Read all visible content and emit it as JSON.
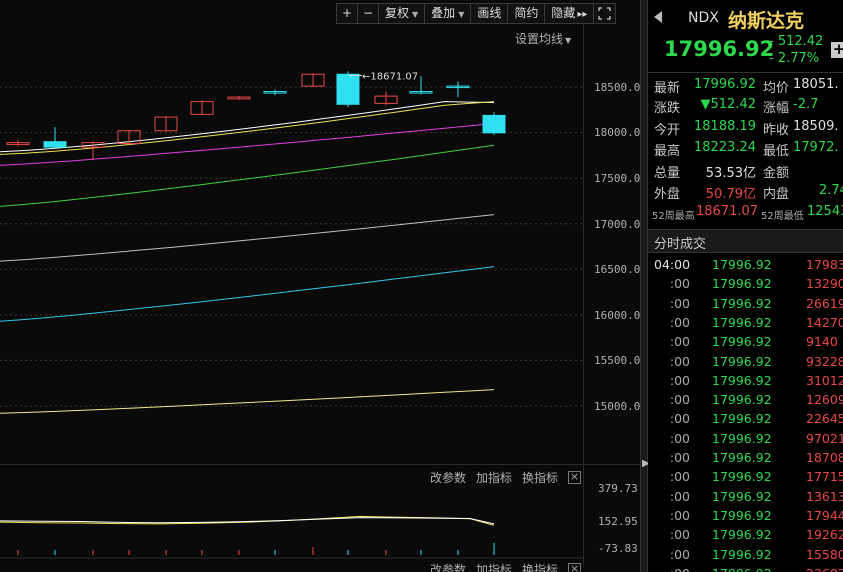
{
  "toolbar": {
    "zoom_in": "+",
    "zoom_out": "−",
    "adjust": "复权",
    "overlay": "叠加",
    "draw": "画线",
    "simple": "简约",
    "hide": "隐藏",
    "expand_arrows": "▸▸",
    "fullscreen_icon": "fullscreen-icon"
  },
  "ma_setting": "设置均线",
  "price_axis": [
    "18500.0",
    "18000.0",
    "17500.0",
    "17000.0",
    "16500.0",
    "16000.0",
    "15500.0",
    "15000.0"
  ],
  "high_marker": "18671.07",
  "indicator_panel": {
    "controls": [
      "改参数",
      "加指标",
      "换指标"
    ],
    "axis": [
      "379.73",
      "152.95",
      "-73.83"
    ]
  },
  "indicator_panel_2": {
    "controls": [
      "改参数",
      "加指标",
      "换指标"
    ]
  },
  "header": {
    "code": "NDX",
    "name": "纳斯达克"
  },
  "price": {
    "last": "17996.92",
    "change": "- 512.42",
    "change_pct": "- 2.77%",
    "add_icon": "+"
  },
  "quote": {
    "latest_label": "最新",
    "latest": "17996.92",
    "avg_label": "均价",
    "avg": "18051.",
    "chg_label": "涨跌",
    "chg": "▼512.42",
    "chgpct_label": "涨幅",
    "chgpct": "-2.7",
    "open_label": "今开",
    "open": "18188.19",
    "prevclose_label": "昨收",
    "prevclose": "18509.",
    "high_label": "最高",
    "high": "18223.24",
    "low_label": "最低",
    "low": "17972.",
    "vol_label": "总量",
    "vol": "53.53亿",
    "amount_label": "金额",
    "amount": "",
    "outer_label": "外盘",
    "outer": "50.79亿",
    "inner_label": "内盘",
    "inner": "2.74",
    "w52high_label": "52周最高",
    "w52high": "18671.07",
    "w52low_label": "52周最低",
    "w52low": "12543."
  },
  "trades": {
    "title": "分时成交",
    "rows": [
      {
        "time": "04:00",
        "price": "17996.92",
        "vol": "17983"
      },
      {
        "time": ":00",
        "price": "17996.92",
        "vol": "13290"
      },
      {
        "time": ":00",
        "price": "17996.92",
        "vol": "26619"
      },
      {
        "time": ":00",
        "price": "17996.92",
        "vol": "14270"
      },
      {
        "time": ":00",
        "price": "17996.92",
        "vol": "9140"
      },
      {
        "time": ":00",
        "price": "17996.92",
        "vol": "93228"
      },
      {
        "time": ":00",
        "price": "17996.92",
        "vol": "31012"
      },
      {
        "time": ":00",
        "price": "17996.92",
        "vol": "12609"
      },
      {
        "time": ":00",
        "price": "17996.92",
        "vol": "22645"
      },
      {
        "time": ":00",
        "price": "17996.92",
        "vol": "97021"
      },
      {
        "time": ":00",
        "price": "17996.92",
        "vol": "18708"
      },
      {
        "time": ":00",
        "price": "17996.92",
        "vol": "17715"
      },
      {
        "time": ":00",
        "price": "17996.92",
        "vol": "13613"
      },
      {
        "time": ":00",
        "price": "17996.92",
        "vol": "17944"
      },
      {
        "time": ":00",
        "price": "17996.92",
        "vol": "19262"
      },
      {
        "time": ":00",
        "price": "17996.92",
        "vol": "15580"
      },
      {
        "time": ":00",
        "price": "17996.92",
        "vol": "23683"
      }
    ]
  },
  "colors": {
    "up": "#e84848",
    "down": "#2cd94c",
    "flat": "#30e0f0",
    "ma5": "#ffffff",
    "ma10": "#f0e050",
    "ma20": "#e040e0",
    "ma30": "#40d040",
    "ma60": "#c0c0c0",
    "ma120": "#30c8e8",
    "ma250": "#f0e890",
    "name_yellow": "#f0d060"
  },
  "chart_data": {
    "type": "candlestick",
    "y_axis": {
      "min": 14700,
      "max": 18900,
      "ticks": [
        15000,
        15500,
        16000,
        16500,
        17000,
        17500,
        18000,
        18500
      ]
    },
    "high_label": 18671.07,
    "candles": [
      {
        "o": 17870,
        "c": 17890,
        "h": 17920,
        "l": 17850
      },
      {
        "o": 17900,
        "c": 17840,
        "h": 18060,
        "l": 17830
      },
      {
        "o": 17840,
        "c": 17890,
        "h": 17905,
        "l": 17700
      },
      {
        "o": 17880,
        "c": 18020,
        "h": 18030,
        "l": 17870
      },
      {
        "o": 18020,
        "c": 18170,
        "h": 18180,
        "l": 18010
      },
      {
        "o": 18200,
        "c": 18340,
        "h": 18350,
        "l": 18195
      },
      {
        "o": 18370,
        "c": 18390,
        "h": 18400,
        "l": 18360
      },
      {
        "o": 18450,
        "c": 18440,
        "h": 18470,
        "l": 18410
      },
      {
        "o": 18510,
        "c": 18640,
        "h": 18650,
        "l": 18500
      },
      {
        "o": 18640,
        "c": 18310,
        "h": 18671.07,
        "l": 18280
      },
      {
        "o": 18320,
        "c": 18400,
        "h": 18450,
        "l": 18300
      },
      {
        "o": 18450,
        "c": 18440,
        "h": 18620,
        "l": 18420
      },
      {
        "o": 18510,
        "c": 18500,
        "h": 18560,
        "l": 18390
      },
      {
        "o": 18188.19,
        "c": 17996.92,
        "h": 18223.24,
        "l": 17972
      }
    ],
    "ma_lines": [
      {
        "name": "MA5",
        "start": 17790,
        "end": 18420
      },
      {
        "name": "MA10",
        "start": 17760,
        "end": 18380
      },
      {
        "name": "MA20",
        "start": 17640,
        "end": 18100
      },
      {
        "name": "MA30",
        "start": 17190,
        "end": 17860
      },
      {
        "name": "MA60",
        "start": 16590,
        "end": 17100
      },
      {
        "name": "MA120",
        "start": 15930,
        "end": 16530
      },
      {
        "name": "MA250",
        "start": 14920,
        "end": 15180
      }
    ],
    "indicator": {
      "y_range": [
        -73.83,
        379.73
      ],
      "line1": [
        152,
        148,
        146,
        142,
        140,
        145,
        150,
        160,
        175,
        190,
        185,
        180,
        175,
        130
      ],
      "line2": [
        160,
        158,
        156,
        150,
        148,
        150,
        155,
        162,
        172,
        182,
        180,
        178,
        176,
        140
      ]
    }
  }
}
